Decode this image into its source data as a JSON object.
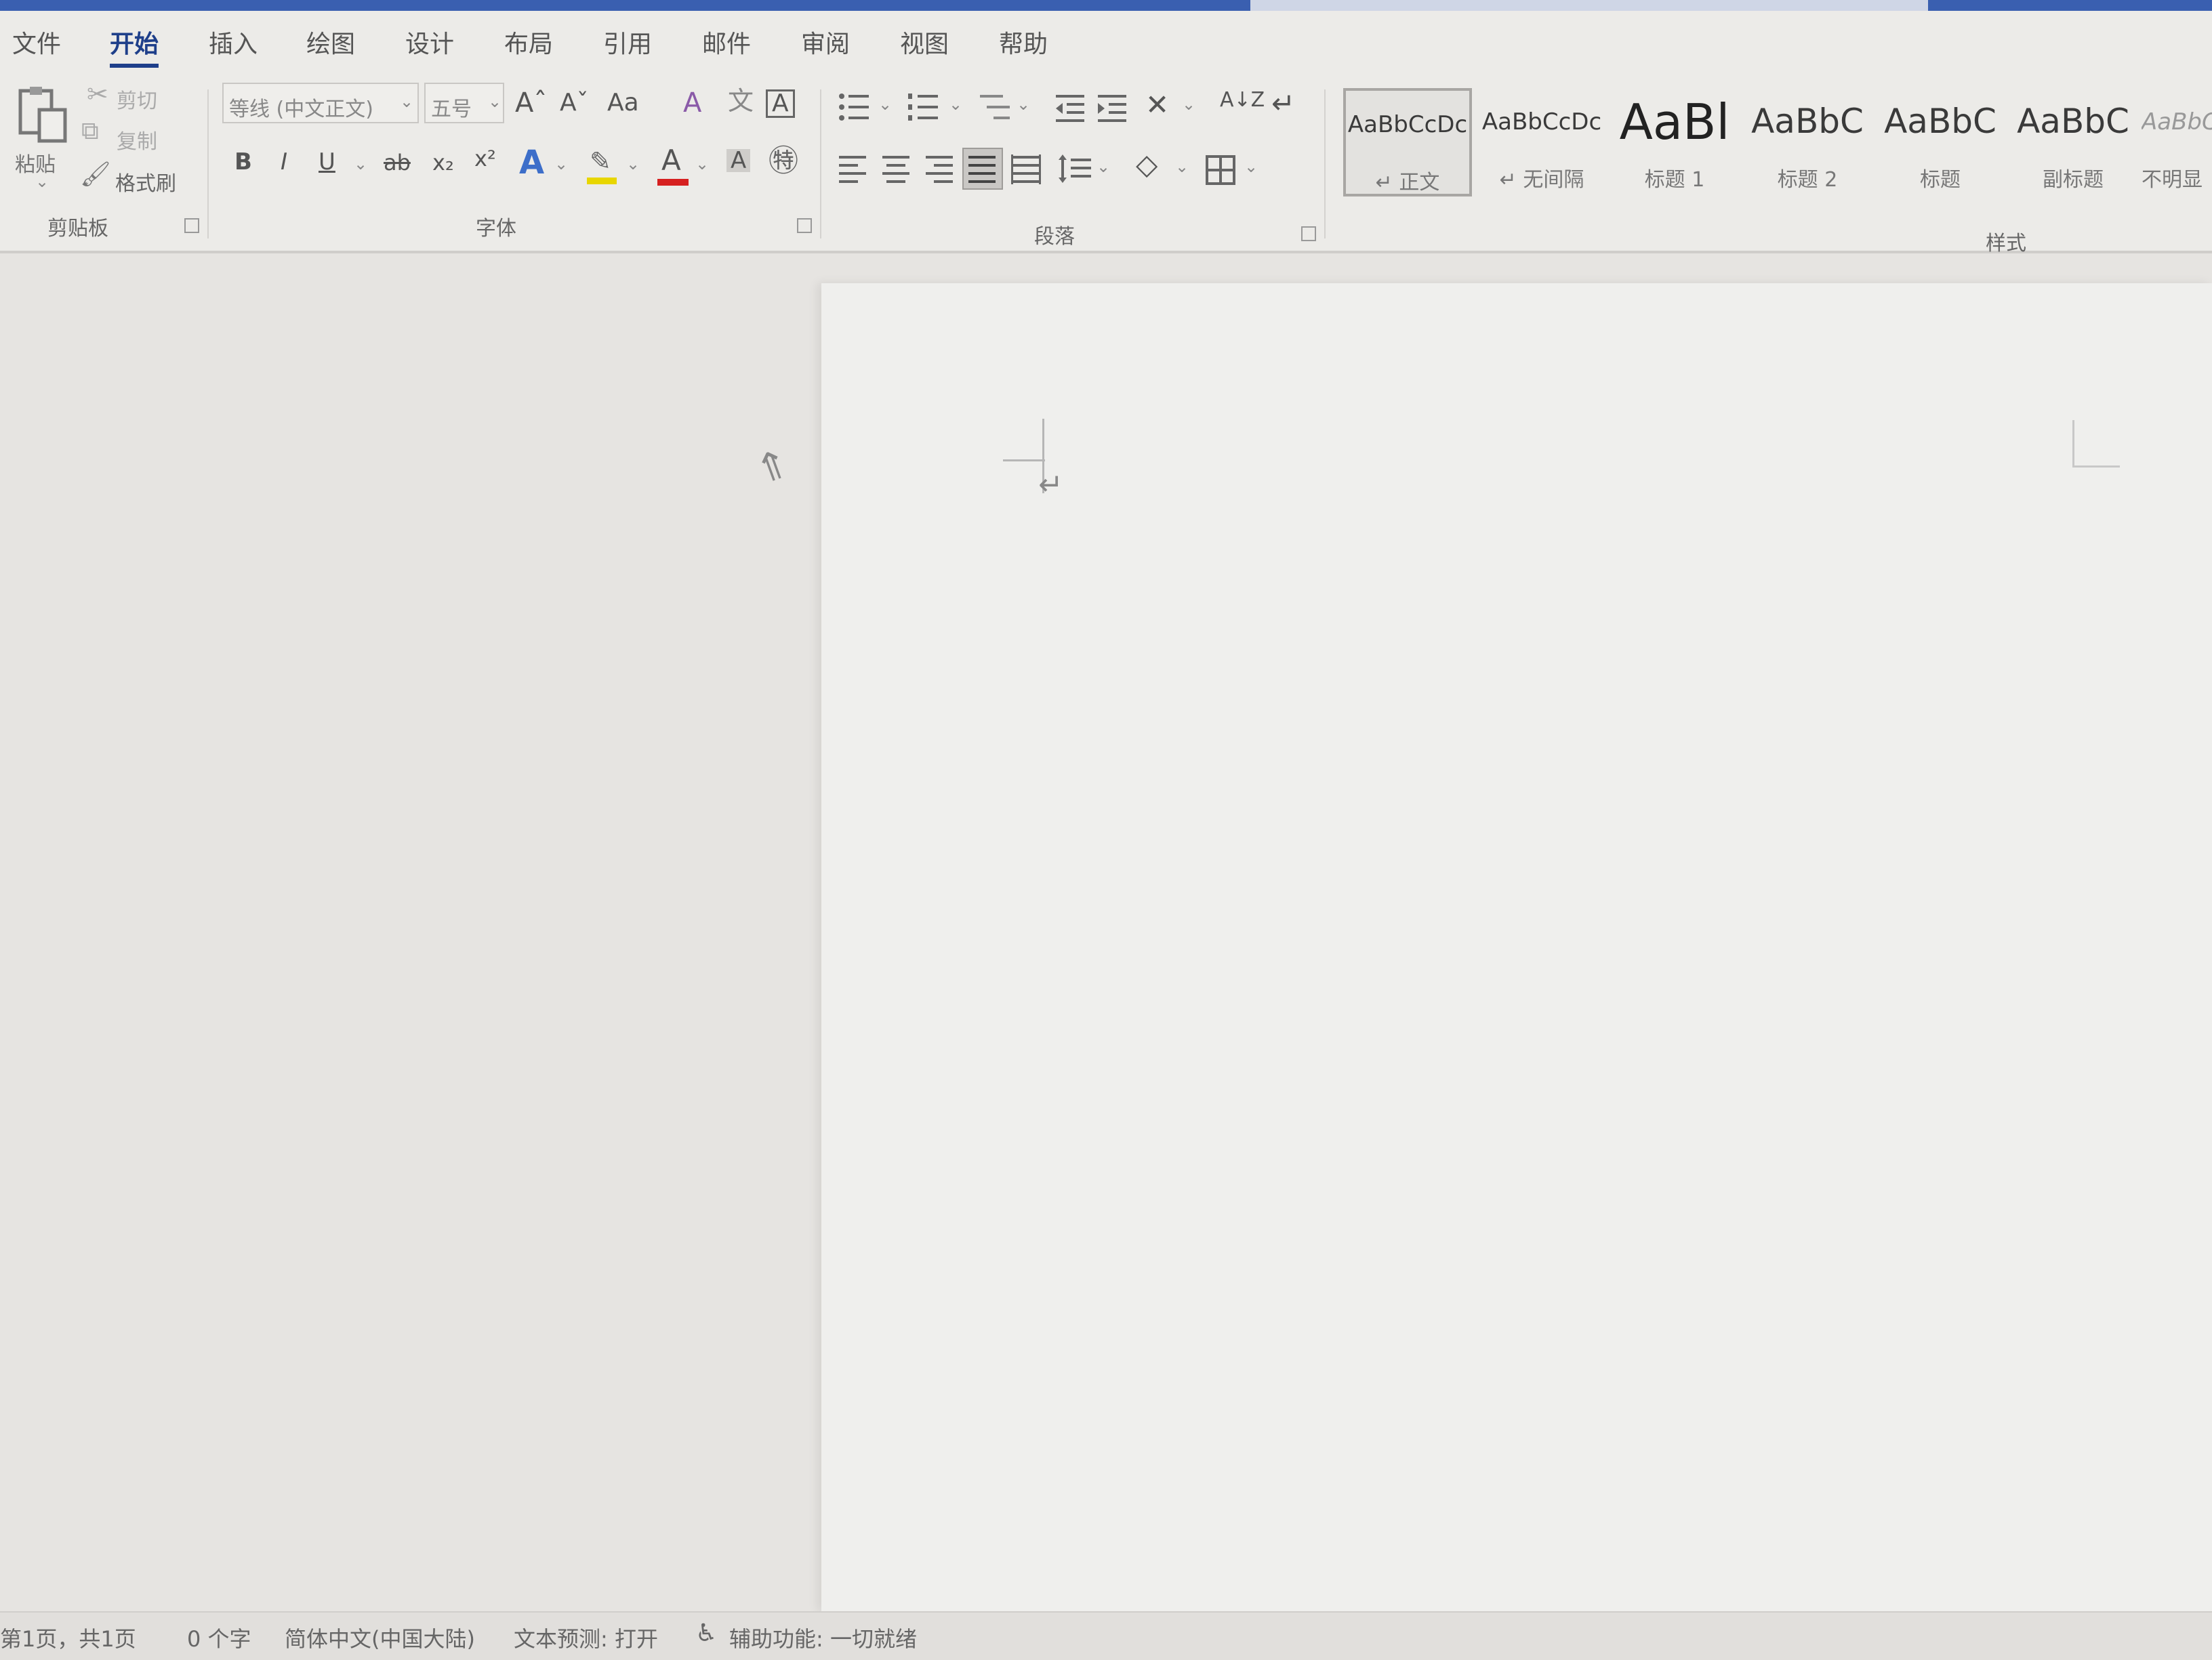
{
  "menu": {
    "tabs": [
      {
        "id": "file",
        "label": "文件"
      },
      {
        "id": "home",
        "label": "开始"
      },
      {
        "id": "insert",
        "label": "插入"
      },
      {
        "id": "draw",
        "label": "绘图"
      },
      {
        "id": "design",
        "label": "设计"
      },
      {
        "id": "layout",
        "label": "布局"
      },
      {
        "id": "references",
        "label": "引用"
      },
      {
        "id": "mailings",
        "label": "邮件"
      },
      {
        "id": "review",
        "label": "审阅"
      },
      {
        "id": "view",
        "label": "视图"
      },
      {
        "id": "help",
        "label": "帮助"
      }
    ],
    "active": "开始"
  },
  "clipboard": {
    "paste_label": "粘贴",
    "cut_label": "剪切",
    "copy_label": "复制",
    "format_painter_label": "格式刷",
    "group_label": "剪贴板"
  },
  "font": {
    "font_name": "等线 (中文正文)",
    "font_size": "五号",
    "grow": "Aˆ",
    "shrink": "Aˇ",
    "change_case": "Aa",
    "bold": "B",
    "italic": "I",
    "underline": "U",
    "strike": "ab",
    "subscript": "x₂",
    "superscript": "x²",
    "text_effects": "A",
    "font_color": "A",
    "char_shading": "A",
    "group_label": "字体"
  },
  "paragraph": {
    "group_label": "段落",
    "sort": "A↓Z"
  },
  "styles": {
    "group_label": "样式",
    "items": [
      {
        "sample": "AaBbCcDc",
        "name": "↵ 正文"
      },
      {
        "sample": "AaBbCcDc",
        "name": "↵ 无间隔"
      },
      {
        "sample": "AaBl",
        "name": "标题 1"
      },
      {
        "sample": "AaBbC",
        "name": "标题 2"
      },
      {
        "sample": "AaBbC",
        "name": "标题"
      },
      {
        "sample": "AaBbC",
        "name": "副标题"
      },
      {
        "sample": "AaBbC",
        "name": "不明显"
      }
    ]
  },
  "document": {
    "paragraph_mark": "↵"
  },
  "status": {
    "page": "第1页，共1页",
    "words": "0 个字",
    "language": "简体中文(中国大陆)",
    "prediction": "文本预测: 打开",
    "accessibility": "辅助功能: 一切就绪"
  },
  "colors": {
    "accent": "#1e3f8a",
    "font_color_bar": "#d62020",
    "highlight_bar": "#e8d600",
    "text_effect_blue": "#3d6ec9"
  }
}
